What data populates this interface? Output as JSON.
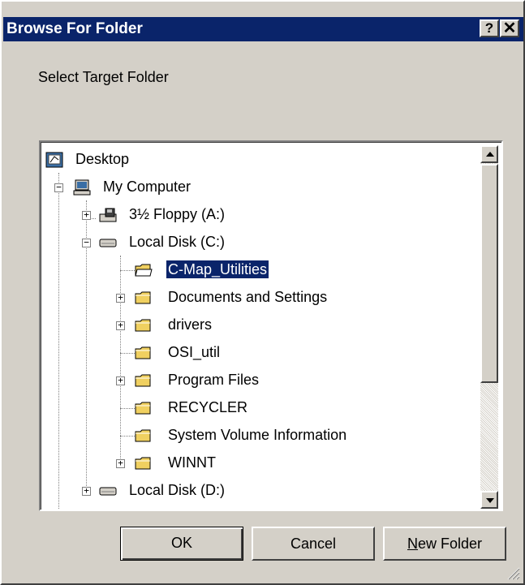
{
  "window": {
    "title": "Browse For Folder",
    "help_glyph": "?",
    "close_glyph": "✕"
  },
  "prompt": "Select Target Folder",
  "tree": {
    "items": [
      {
        "label": "Desktop",
        "icon": "desktop-icon",
        "expander": ""
      },
      {
        "label": "My Computer",
        "icon": "computer-icon",
        "expander": "−"
      },
      {
        "label": "3½ Floppy (A:)",
        "icon": "floppy-drive-icon",
        "expander": "+"
      },
      {
        "label": "Local Disk (C:)",
        "icon": "hard-drive-icon",
        "expander": "−"
      },
      {
        "label": "C-Map_Utilities",
        "icon": "folder-open-icon",
        "expander": "",
        "selected": true
      },
      {
        "label": "Documents and Settings",
        "icon": "folder-icon",
        "expander": "+"
      },
      {
        "label": "drivers",
        "icon": "folder-icon",
        "expander": "+"
      },
      {
        "label": "OSI_util",
        "icon": "folder-icon",
        "expander": ""
      },
      {
        "label": "Program Files",
        "icon": "folder-icon",
        "expander": "+"
      },
      {
        "label": "RECYCLER",
        "icon": "folder-icon",
        "expander": ""
      },
      {
        "label": "System Volume Information",
        "icon": "folder-icon",
        "expander": ""
      },
      {
        "label": "WINNT",
        "icon": "folder-icon",
        "expander": "+"
      },
      {
        "label": "Local Disk (D:)",
        "icon": "hard-drive-icon",
        "expander": "+"
      }
    ]
  },
  "buttons": {
    "ok": "OK",
    "cancel": "Cancel",
    "new_folder_mnemonic": "N",
    "new_folder_rest": "ew Folder"
  },
  "colors": {
    "selection": "#0a246a",
    "title_bar": "#0a246a",
    "face": "#d4d0c8",
    "folder": "#f0d060"
  }
}
